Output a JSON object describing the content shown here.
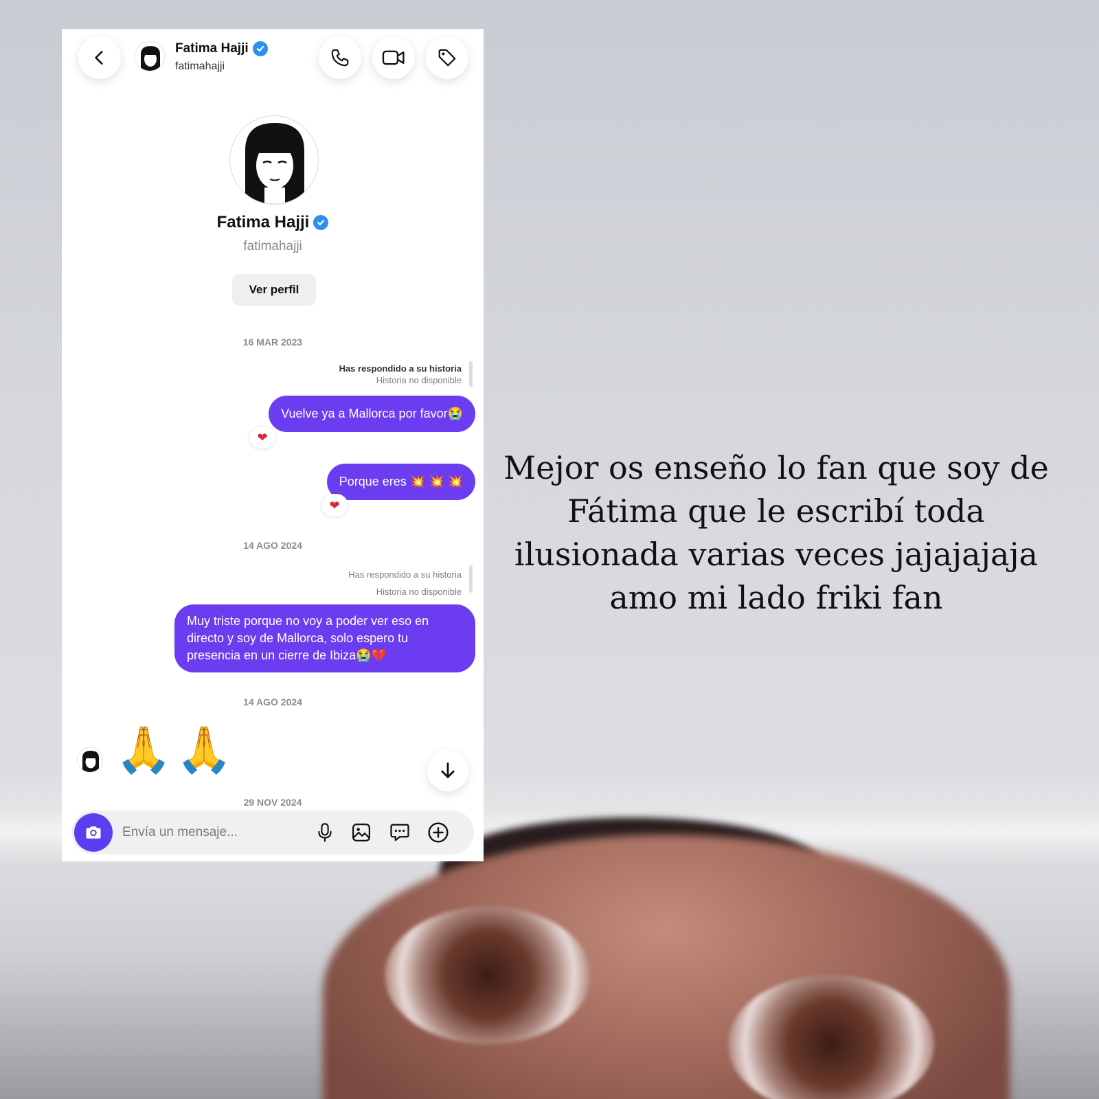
{
  "header": {
    "name": "Fatima Hajji",
    "username": "fatimahajji"
  },
  "profile": {
    "name": "Fatima Hajji",
    "username": "fatimahajji",
    "view_profile_label": "Ver perfil"
  },
  "messages": [
    {
      "date": "16 MAR 2023"
    },
    {
      "reply_note": "Has respondido a su historia",
      "story_status": "Historia no disponible"
    },
    {
      "text": "Vuelve ya a Mallorca por favor😭",
      "reaction": "❤"
    },
    {
      "text": "Porque eres 💥 💥 💥",
      "reaction": "❤"
    },
    {
      "date": "14 AGO 2024"
    },
    {
      "reply_note": "Has respondido a su historia",
      "story_status": "Historia no disponible"
    },
    {
      "text": "Muy triste porque no voy a poder ver eso en directo y soy de Mallorca, solo espero tu presencia en un cierre de Ibiza😭💔"
    },
    {
      "date": "14 AGO 2024"
    },
    {
      "incoming_emoji": "🙏🙏"
    },
    {
      "date": "29 NOV 2024"
    }
  ],
  "composer": {
    "placeholder": "Envía un mensaje..."
  },
  "icons": {
    "back": "chevron-left-icon",
    "call": "phone-icon",
    "video": "video-camera-icon",
    "tag": "tag-icon",
    "camera": "camera-icon",
    "mic": "microphone-icon",
    "gallery": "image-icon",
    "sticker": "chat-bubble-icon",
    "add": "plus-circle-icon",
    "scroll": "arrow-down-icon"
  },
  "colors": {
    "bubble": "#6c3cf0",
    "verified": "#2f8ff0",
    "camera_button": "#5a3ff0"
  },
  "caption": "Mejor os enseño lo fan que soy de Fátima que le escribí toda ilusionada varias veces jajajajaja amo mi lado friki fan"
}
